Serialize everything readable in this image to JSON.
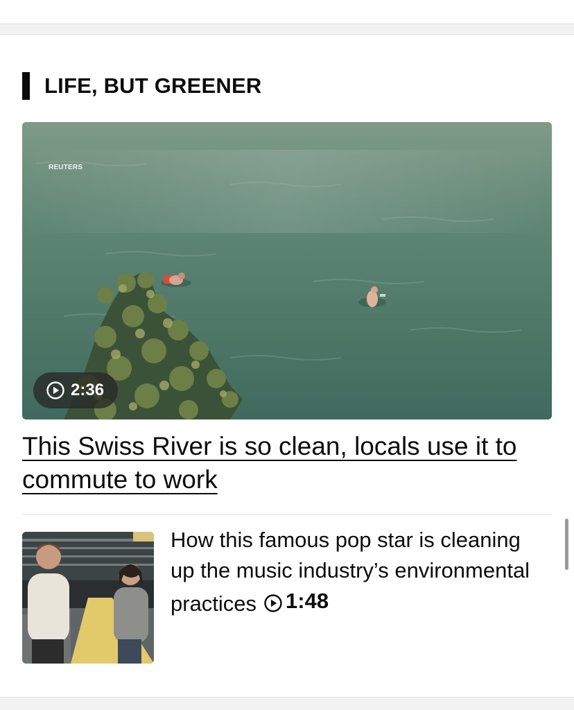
{
  "section": {
    "title": "LIFE, BUT GREENER"
  },
  "hero": {
    "source_credit": "REUTERS",
    "duration": "2:36",
    "headline": "This Swiss River is so clean, locals use it to commute to work",
    "play_icon": "play-circle-icon"
  },
  "stories": [
    {
      "headline": "How this famous pop star is cleaning up the music industry’s environmental practices",
      "duration": "1:48",
      "play_icon": "play-circle-icon"
    }
  ],
  "colors": {
    "text": "#0c0c0c",
    "divider": "#e0e0e0",
    "band": "#f2f2f2",
    "river": "#4f7565"
  }
}
